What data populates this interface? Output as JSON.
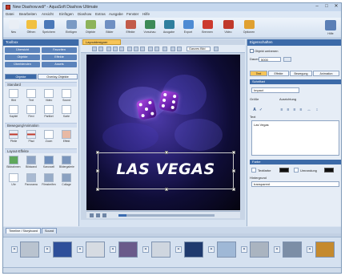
{
  "window": {
    "title": "New Diashow.wdi* - AquaSoft Diashow Ultimate",
    "controls": [
      "–",
      "□",
      "✕"
    ]
  },
  "menu": [
    "Datei",
    "Bearbeiten",
    "Ansicht",
    "Einfügen",
    "Diashow",
    "Extras",
    "Ausgabe",
    "Fenster",
    "Hilfe"
  ],
  "toolbar": [
    {
      "label": "Neu",
      "color": "#e9eef5"
    },
    {
      "label": "Öffnen",
      "color": "#f1c040"
    },
    {
      "label": "Speichern",
      "color": "#4a78b8"
    },
    {
      "label": "Einfügen",
      "color": "#7a9ac4"
    },
    {
      "label": "Objekte",
      "color": "#8db35a"
    },
    {
      "label": "Bilder",
      "color": "#6f8fc2"
    },
    {
      "label": "Effekte",
      "color": "#c25b4a"
    },
    {
      "label": "Vorschau",
      "color": "#3d8a57"
    },
    {
      "label": "Ausgabe",
      "color": "#2f7f9e"
    },
    {
      "label": "Export",
      "color": "#4e8bd3"
    },
    {
      "label": "Brennen",
      "color": "#cc3a2e"
    },
    {
      "label": "Video",
      "color": "#c0392b"
    },
    {
      "label": "Optionen",
      "color": "#e0a030"
    },
    {
      "label": "Hilfe",
      "color": "#5b7fb6"
    }
  ],
  "toolbar_help": "Hilfe",
  "left_panel": {
    "title": "Toolbox",
    "links": [
      "Übersicht",
      "Favoriten",
      "Objekte",
      "Effekte",
      "Überblenden",
      "Assets"
    ],
    "subtabs": [
      "Objekte",
      "Overlay-Objekte"
    ],
    "sections": [
      "Standard",
      "Bewegung/Animation",
      "Layout-Effekte"
    ],
    "objects_row1": [
      "Bild",
      "Text",
      "Video",
      "Sound"
    ],
    "objects_row2": [
      "Kapitel",
      "Flexi",
      "Partikel",
      "Karte"
    ],
    "anim_row": [
      "Pfeile",
      "Pfad",
      "Zoom",
      "Effekt"
    ],
    "layout_row1": [
      "Bildrahmen",
      "Bildwand",
      "Karussell",
      "Bildergalerie"
    ],
    "layout_row2": [
      "Uhr",
      "Panorama",
      "Filmstreifen",
      "Collage"
    ]
  },
  "center": {
    "tab_label": "Layoutdesigner",
    "zoom": "Ganzes Bild",
    "caption": "LAS VEGAS",
    "progress": 0.08
  },
  "right_panel": {
    "title": "Eigenschaften",
    "checkbox_label": "Objekt umbenen",
    "duration_label": "Dauer",
    "duration_value": "5000",
    "tabs": [
      "Text",
      "Effekte",
      "Bewegung",
      "Animation"
    ],
    "section_text": "Schriftart",
    "font_value": "Impact",
    "size_label": "Größe",
    "align_label": "Ausrichtung",
    "text_label": "Text",
    "text_value": "Las Vegas",
    "section_color": "Farbe",
    "color1_label": "Textfarbe",
    "color2_label": "Umrandung",
    "bg_label": "Hintergrund",
    "bg_value": "transparent"
  },
  "storyboard": {
    "tabs": [
      "Timeline / Storyboard",
      "Sound"
    ],
    "slides": [
      "#b9c3cf",
      "#2e4f9a",
      "#d6dbe2",
      "#6a5a8a",
      "#cfd6df",
      "#1f3a6e",
      "#9fb8d6",
      "#aab4c0",
      "#7c8ea6",
      "#c58a2e"
    ]
  },
  "colors": {
    "accent": "#3c6aa8",
    "canvas_bg": "#0f0d37",
    "dice": "#8a34c8",
    "highlight_tab": "#f6c458"
  }
}
